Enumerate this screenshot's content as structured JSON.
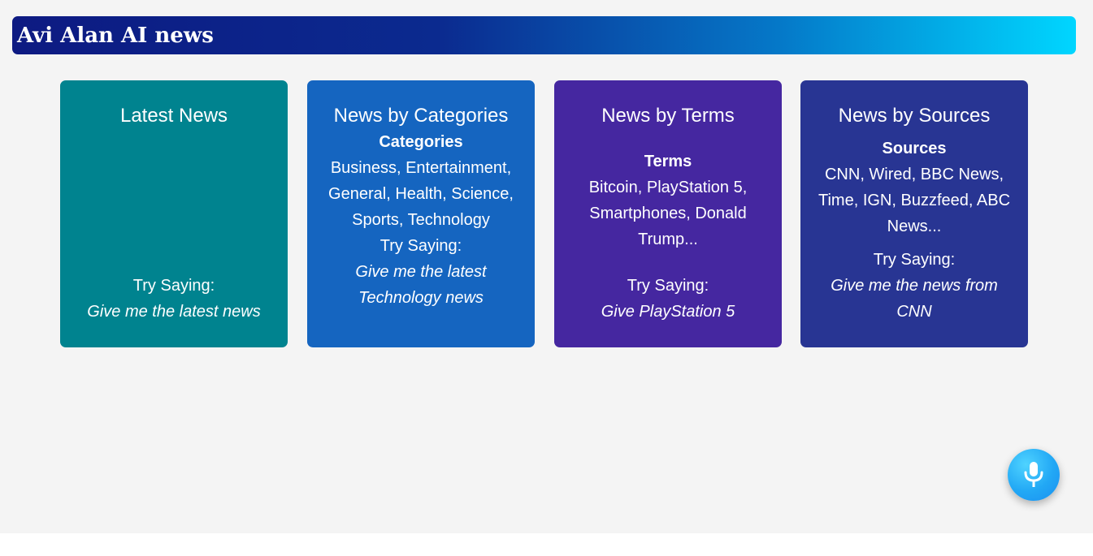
{
  "header": {
    "title": "Avi Alan AI news"
  },
  "cards": [
    {
      "title": "Latest News",
      "try_label": "Try Saying:",
      "example": "Give me the latest news",
      "color": "#00838f"
    },
    {
      "title": "News by Categories",
      "section_label": "Categories",
      "list_text": "Business, Entertainment, General, Health, Science, Sports, Technology",
      "try_label": "Try Saying:",
      "example": "Give me the latest Technology news",
      "color": "#1565c0"
    },
    {
      "title": "News by Terms",
      "section_label": "Terms",
      "list_text": "Bitcoin, PlayStation 5, Smartphones, Donald Trump...",
      "try_label": "Try Saying:",
      "example": "Give PlayStation 5",
      "color": "#4527a0"
    },
    {
      "title": "News by Sources",
      "section_label": "Sources",
      "list_text": "CNN, Wired, BBC News, Time, IGN, Buzzfeed, ABC News...",
      "try_label": "Try Saying:",
      "example": "Give me the news from CNN",
      "color": "#283593"
    }
  ],
  "mic": {
    "icon": "microphone-icon",
    "color": "#22a8f5"
  }
}
